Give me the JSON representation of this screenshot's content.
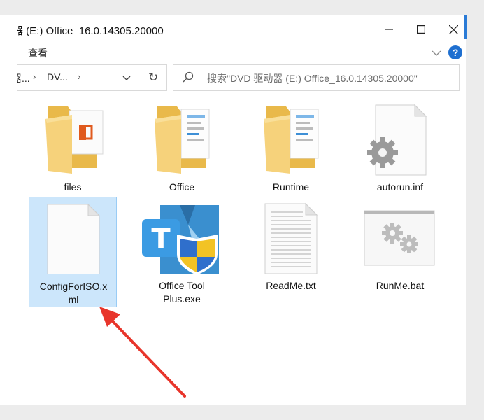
{
  "window": {
    "title": "器 (E:) Office_16.0.14305.20000",
    "minimize_icon": "minimize-icon",
    "maximize_icon": "maximize-icon",
    "close_icon": "close-icon"
  },
  "ribbon": {
    "view_tab": "查看",
    "help_label": "?"
  },
  "address": {
    "crumbs": [
      "器...",
      "DV..."
    ],
    "separator": "›",
    "refresh_glyph": "↻"
  },
  "search": {
    "placeholder": "搜索\"DVD 驱动器 (E:) Office_16.0.14305.20000\""
  },
  "files": [
    {
      "name": "files",
      "icon": "office-folder-icon"
    },
    {
      "name": "Office",
      "icon": "folder-icon"
    },
    {
      "name": "Runtime",
      "icon": "folder-icon"
    },
    {
      "name": "autorun.inf",
      "icon": "settings-file-icon"
    },
    {
      "name": "ConfigForISO.xml",
      "icon": "blank-file-icon",
      "selected": true,
      "line1": "ConfigForISO.x",
      "line2": "ml"
    },
    {
      "name": "Office Tool Plus.exe",
      "icon": "office-tool-plus-icon",
      "line1": "Office Tool",
      "line2": "Plus.exe"
    },
    {
      "name": "ReadMe.txt",
      "icon": "text-file-icon"
    },
    {
      "name": "RunMe.bat",
      "icon": "batch-file-icon"
    }
  ],
  "colors": {
    "selection_bg": "#cce6fb",
    "accent": "#1e6fd0",
    "annotation_arrow": "#e8352b"
  }
}
